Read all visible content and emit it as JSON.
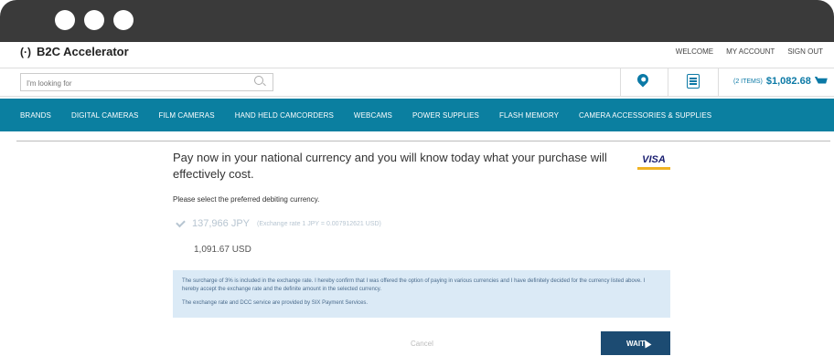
{
  "brand": {
    "name": "B2C Accelerator"
  },
  "toplinks": [
    "WELCOME",
    "MY ACCOUNT",
    "SIGN OUT"
  ],
  "search": {
    "placeholder": "I'm looking for"
  },
  "cart": {
    "items_label": "(2 ITEMS)",
    "total": "$1,082.68"
  },
  "nav": [
    "BRANDS",
    "DIGITAL CAMERAS",
    "FILM CAMERAS",
    "HAND HELD CAMCORDERS",
    "WEBCAMS",
    "POWER SUPPLIES",
    "FLASH MEMORY",
    "CAMERA ACCESSORIES & SUPPLIES"
  ],
  "dcc": {
    "heading": "Pay now in your national currency and you will know today what your purchase will effectively cost.",
    "card_brand": "VISA",
    "select_label": "Please select the preferred debiting currency.",
    "option_foreign_amount": "137,966 JPY",
    "option_foreign_rate": "(Exchange rate 1 JPY = 0.007912621 USD)",
    "option_home": "1,091.67 USD",
    "terms": "The surcharge of 3% is included in the exchange rate. I hereby confirm that I was offered the option of paying in various currencies and I have definitely decided for the currency listed above. I hereby accept the exchange rate and the definite amount in the selected currency.",
    "provider": "The exchange rate and DCC service are provided by SIX Payment Services.",
    "cancel_label": "Cancel",
    "wait_label": "WAIT"
  },
  "colors": {
    "nav_bg": "#0b7fa0",
    "accent": "#0b79a6",
    "button_bg": "#1c4b72",
    "info_bg": "#dbeaf6"
  }
}
